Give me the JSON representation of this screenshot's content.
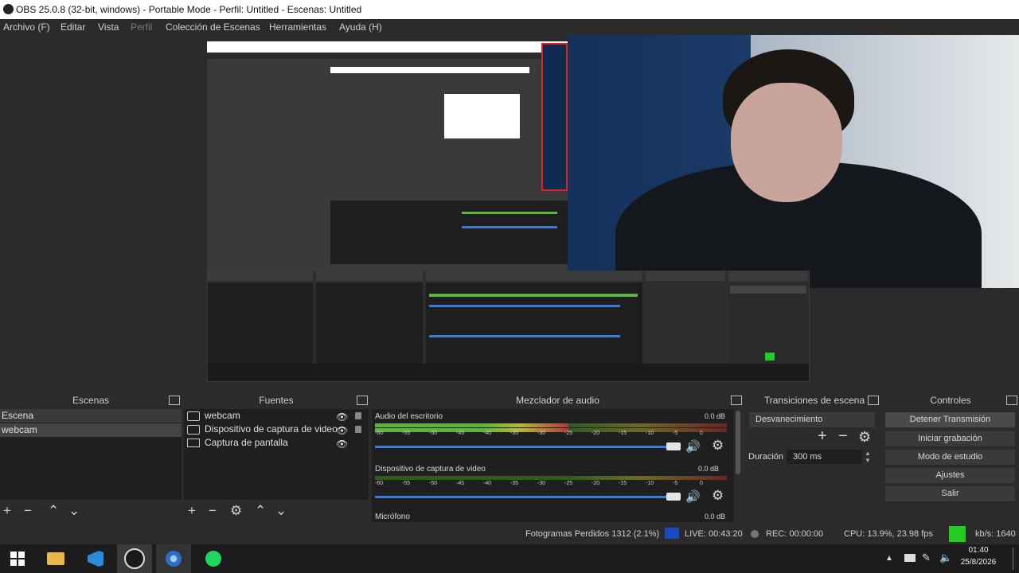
{
  "window": {
    "title": "OBS 25.0.8 (32-bit, windows) - Portable Mode - Perfil: Untitled - Escenas: Untitled"
  },
  "menu": {
    "items": [
      "Archivo (F)",
      "Editar",
      "Vista",
      "Perfil",
      "Colección de Escenas",
      "Herramientas",
      "Ayuda (H)"
    ]
  },
  "docks": {
    "scenes": {
      "title": "Escenas",
      "items": [
        "Escena",
        "webcam"
      ]
    },
    "sources": {
      "title": "Fuentes",
      "items": [
        {
          "label": "webcam",
          "icon": "camera-icon"
        },
        {
          "label": "Dispositivo de captura de video",
          "icon": "camera-icon"
        },
        {
          "label": "Captura de pantalla",
          "icon": "monitor-icon"
        }
      ]
    },
    "mixer": {
      "title": "Mezclador de audio",
      "channels": [
        {
          "name": "Audio del escritorio",
          "db": "0.0 dB",
          "level": 0.55
        },
        {
          "name": "Dispositivo de captura de video",
          "db": "0.0 dB",
          "level": 0.0
        }
      ],
      "ticks": [
        "-60",
        "-55",
        "-50",
        "-45",
        "-40",
        "-35",
        "-30",
        "-25",
        "-20",
        "-15",
        "-10",
        "-5",
        "0"
      ],
      "third_channel": "Micrófono",
      "third_db": "0.0 dB"
    },
    "transitions": {
      "title": "Transiciones de escena",
      "selected": "Desvanecimiento",
      "duration_label": "Duración",
      "duration_value": "300 ms"
    },
    "controls": {
      "title": "Controles",
      "buttons": [
        "Detener Transmisión",
        "Iniciar grabación",
        "Modo de estudio",
        "Ajustes",
        "Salir"
      ]
    }
  },
  "status": {
    "frames": "Fotogramas Perdidos 1312 (2.1%)",
    "live": "LIVE: 00:43:20",
    "rec": "REC: 00:00:00",
    "cpu": "CPU: 13.9%, 23.98 fps",
    "kbps": "kb/s: 1640",
    "live_color": "#1a49c4",
    "status_square_color": "#22cc22"
  },
  "taskbar": {
    "time": "01:40",
    "date": "25/8/2026"
  }
}
